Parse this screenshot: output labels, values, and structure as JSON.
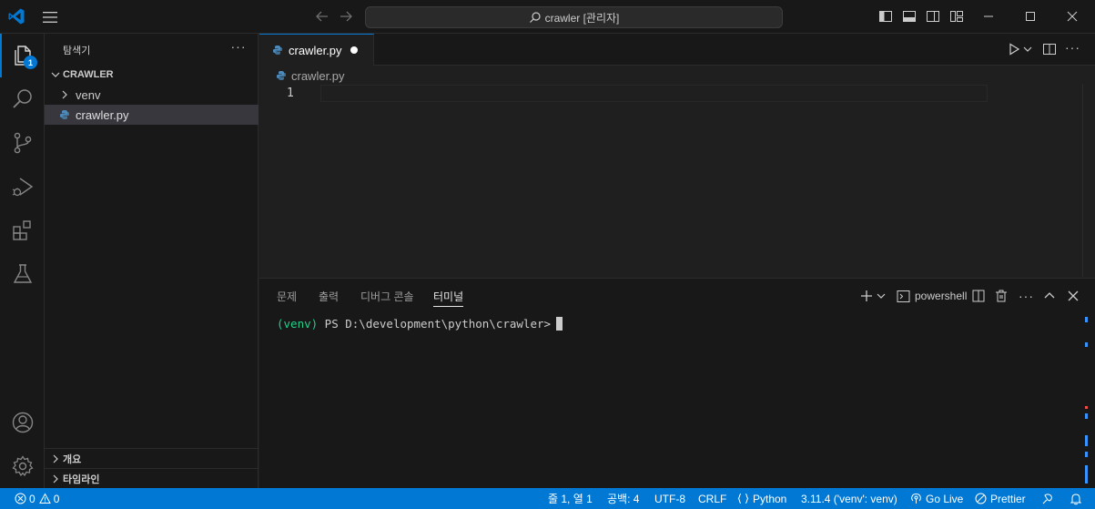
{
  "titlebar": {
    "search_text": "crawler [관리자]"
  },
  "activity": {
    "explorer_badge": "1"
  },
  "sidebar": {
    "title": "탐색기",
    "more": "···",
    "root_folder": "CRAWLER",
    "items": [
      {
        "label": "venv"
      },
      {
        "label": "crawler.py"
      }
    ],
    "outline_label": "개요",
    "timeline_label": "타임라인"
  },
  "editor": {
    "tab_label": "crawler.py",
    "breadcrumb": "crawler.py",
    "line_number": "1"
  },
  "panel": {
    "tabs": [
      "문제",
      "출력",
      "디버그 콘솔",
      "터미널"
    ],
    "active_tab": "터미널",
    "shell_label": "powershell",
    "terminal_venv": "(venv)",
    "terminal_prompt": " PS D:\\development\\python\\crawler>"
  },
  "status": {
    "errors": "0",
    "warnings": "0",
    "position": "줄 1, 열 1",
    "spaces": "공백: 4",
    "encoding": "UTF-8",
    "eol": "CRLF",
    "language": "Python",
    "interpreter": "3.11.4 ('venv': venv)",
    "golive": "Go Live",
    "prettier": "Prettier"
  },
  "colors": {
    "accent": "#0078d4",
    "terminal_green": "#23d18b",
    "python_icon": "#4b8bbe"
  }
}
